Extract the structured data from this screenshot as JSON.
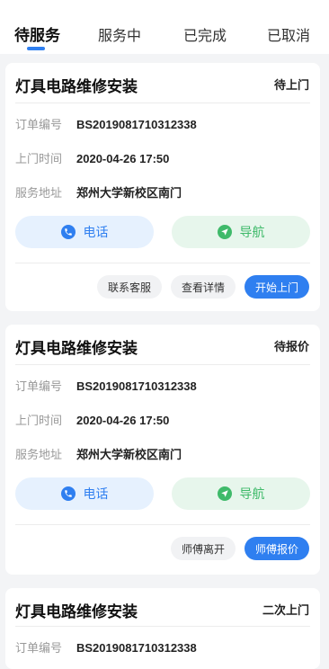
{
  "tabs": [
    {
      "label": "待服务",
      "active": true
    },
    {
      "label": "服务中",
      "active": false
    },
    {
      "label": "已完成",
      "active": false
    },
    {
      "label": "已取消",
      "active": false
    }
  ],
  "labels": {
    "order_no": "订单编号",
    "visit_time": "上门时间",
    "address": "服务地址",
    "call": "电话",
    "navigate": "导航"
  },
  "orders": [
    {
      "title": "灯具电路维修安装",
      "status": "待上门",
      "order_no": "BS2019081710312338",
      "visit_time": "2020-04-26 17:50",
      "address": "郑州大学新校区南门",
      "actions": [
        "联系客服",
        "查看详情",
        "开始上门"
      ]
    },
    {
      "title": "灯具电路维修安装",
      "status": "待报价",
      "order_no": "BS2019081710312338",
      "visit_time": "2020-04-26 17:50",
      "address": "郑州大学新校区南门",
      "actions": [
        "师傅离开",
        "师傅报价"
      ]
    },
    {
      "title": "灯具电路维修安装",
      "status": "二次上门",
      "order_no": "BS2019081710312338"
    }
  ],
  "colors": {
    "accent": "#2f7ff0",
    "nav_green": "#3fba6a",
    "background": "#f3f4f6"
  }
}
